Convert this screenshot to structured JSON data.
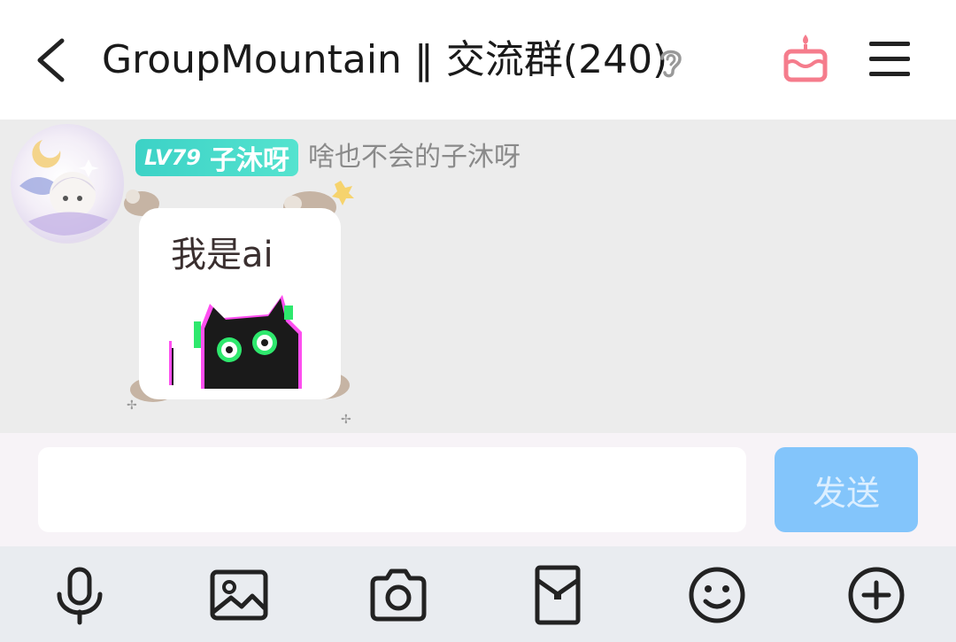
{
  "header": {
    "title": "GroupMountain ‖ 交流群(240)",
    "icons": {
      "back": "chevron-left-icon",
      "ear": "ear-icon",
      "cake": "cake-icon",
      "menu": "menu-icon"
    },
    "cake_color": "#f57c8c"
  },
  "message": {
    "level": "LV79",
    "nickname": "子沐呀",
    "sender_title": "啥也不会的子沐呀",
    "text": "我是ai",
    "badge_color": "#3cd2c6"
  },
  "input": {
    "value": "",
    "send_label": "发送",
    "send_color": "#83c5fb"
  },
  "toolbar": {
    "icons": [
      "microphone-icon",
      "image-icon",
      "camera-icon",
      "red-packet-icon",
      "emoji-icon",
      "plus-circle-icon"
    ]
  }
}
